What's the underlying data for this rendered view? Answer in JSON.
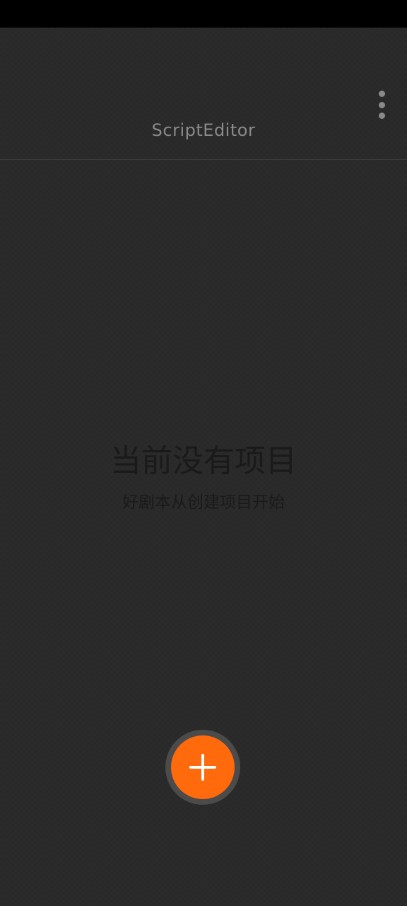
{
  "app_bar": {
    "title": "ScriptEditor",
    "menu_icon": "more-vert-icon"
  },
  "empty_state": {
    "title": "当前没有项目",
    "subtitle": "好剧本从创建项目开始"
  },
  "fab": {
    "icon": "plus-icon",
    "color": "#ff6a0d"
  },
  "colors": {
    "background": "#2b2b2b",
    "status_bar": "#000000",
    "title_text": "#8a8a8a",
    "accent": "#ff6a0d"
  }
}
